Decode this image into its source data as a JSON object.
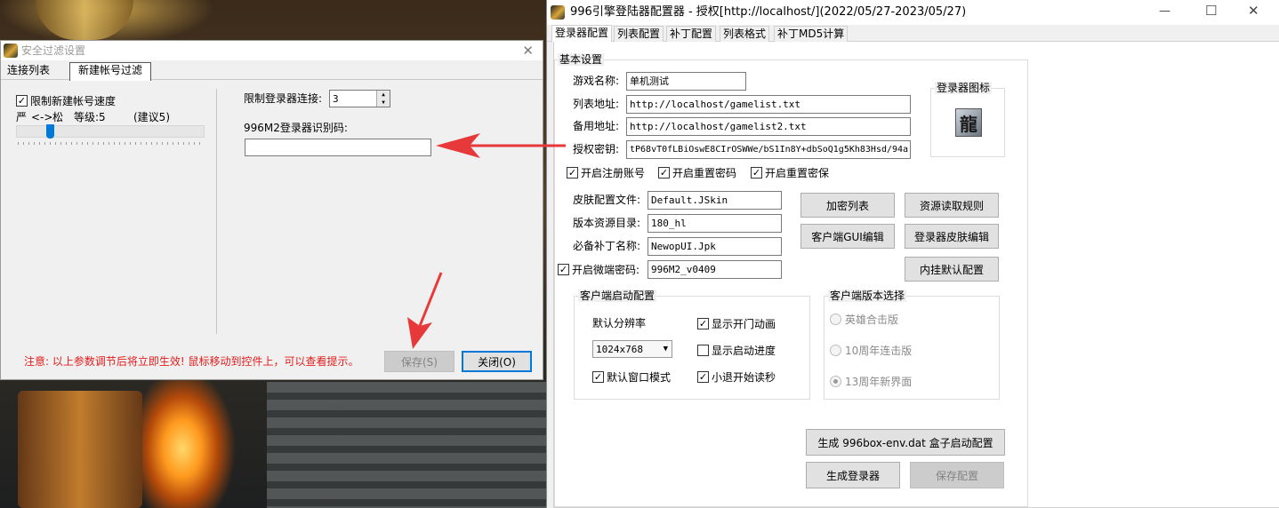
{
  "colors": {
    "accent": "#0078d7",
    "arrow": "#e8393a",
    "notice": "#e41c1c"
  },
  "left_dialog": {
    "title": "安全过滤设置",
    "tabs": [
      "连接列表",
      "新建帐号过滤"
    ],
    "limit_new_account_speed": {
      "label": "限制新建帐号速度",
      "checked": true
    },
    "slider": {
      "strict_label": "严",
      "arrow_label": "<->",
      "loose_label": "松",
      "level_label": "等级:5",
      "suggest_label": "(建议5)",
      "level": 5
    },
    "limit_connections_label": "限制登录器连接:",
    "limit_connections_value": "3",
    "m2_id_label": "996M2登录器识别码:",
    "m2_id_value": "",
    "notice": "注意: 以上参数调节后将立即生效! 鼠标移动到控件上，可以查看提示。",
    "save_button": "保存(S)",
    "close_button": "关闭(O)"
  },
  "main_window": {
    "title": "996引擎登陆器配置器 - 授权[http://localhost/](2022/05/27-2023/05/27)",
    "tabs": [
      "登录器配置",
      "列表配置",
      "补丁配置",
      "列表格式",
      "补丁MD5计算"
    ],
    "basic_group_title": "基本设置",
    "game_name_label": "游戏名称:",
    "game_name_value": "单机测试",
    "list_url_label": "列表地址:",
    "list_url_value": "http://localhost/gamelist.txt",
    "backup_url_label": "备用地址:",
    "backup_url_value": "http://localhost/gamelist2.txt",
    "auth_key_label": "授权密钥:",
    "auth_key_value": "tP68vT0fLBiOswE8CIrOSWWe/bS1In8Y+dbSoQ1g5Kh83Hsd/94a",
    "launcher_icon_title": "登录器图标",
    "launcher_icon_glyph": "龍",
    "check_register": "开启注册账号",
    "check_reset_pwd": "开启重置密码",
    "check_reset_security": "开启重置密保",
    "skin_file_label": "皮肤配置文件:",
    "skin_file_value": "Default.JSkin",
    "res_dir_label": "版本资源目录:",
    "res_dir_value": "180_hl",
    "patch_name_label": "必备补丁名称:",
    "patch_name_value": "NewopUI.Jpk",
    "micro_pwd_label": "开启微端密码:",
    "micro_pwd_value": "996M2_v0409",
    "btn_encrypt_list": "加密列表",
    "btn_res_rules": "资源读取规则",
    "btn_client_gui": "客户端GUI编辑",
    "btn_skin_edit": "登录器皮肤编辑",
    "btn_builtin_default": "内挂默认配置",
    "client_start_title": "客户端启动配置",
    "default_res_label": "默认分辨率",
    "resolution_value": "1024x768",
    "check_show_door_anim": "显示开门动画",
    "check_show_progress": "显示启动进度",
    "check_window_mode": "默认窗口模式",
    "check_small_exit": "小退开始读秒",
    "client_version_title": "客户端版本选择",
    "radio_options": [
      "英雄合击版",
      "10周年连击版",
      "13周年新界面"
    ],
    "radio_selected": 2,
    "btn_gen_env": "生成 996box-env.dat 盒子启动配置",
    "btn_gen_launcher": "生成登录器",
    "btn_save_config": "保存配置"
  }
}
